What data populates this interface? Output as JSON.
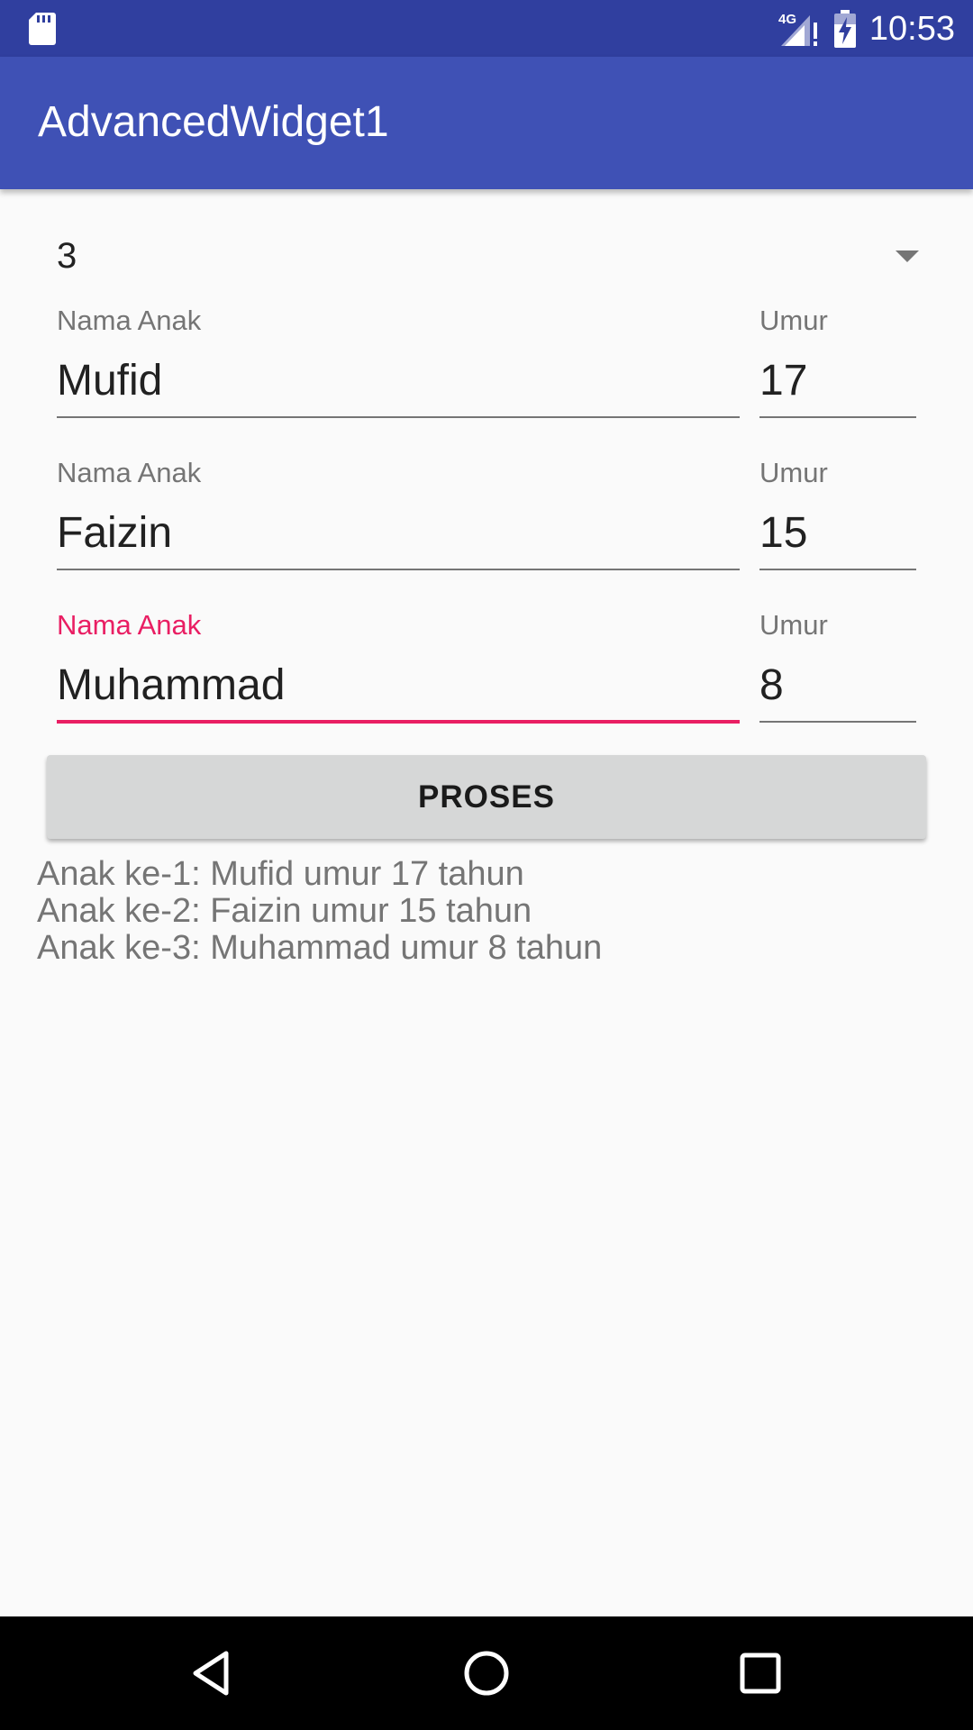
{
  "status_bar": {
    "network_label": "4G",
    "time": "10:53"
  },
  "app_bar": {
    "title": "AdvancedWidget1"
  },
  "spinner": {
    "selected_value": "3"
  },
  "rows": [
    {
      "name_label": "Nama Anak",
      "name_value": "Mufid",
      "age_label": "Umur",
      "age_value": "17"
    },
    {
      "name_label": "Nama Anak",
      "name_value": "Faizin",
      "age_label": "Umur",
      "age_value": "15"
    },
    {
      "name_label": "Nama Anak",
      "name_value": "Muhammad",
      "age_label": "Umur",
      "age_value": "8"
    }
  ],
  "button": {
    "label": "PROSES"
  },
  "results": [
    "Anak ke-1: Mufid umur 17 tahun",
    "Anak ke-2: Faizin umur 15 tahun",
    "Anak ke-3: Muhammad umur 8 tahun"
  ],
  "colors": {
    "status_bar": "#303f9f",
    "app_bar": "#3f51b5",
    "accent": "#e91e63",
    "button": "#d6d7d7"
  },
  "icons": {
    "sd_card": "sd-card-icon",
    "signal": "signal-4g-icon",
    "battery": "battery-charging-icon",
    "back": "back-icon",
    "home": "home-icon",
    "recents": "recents-icon"
  }
}
